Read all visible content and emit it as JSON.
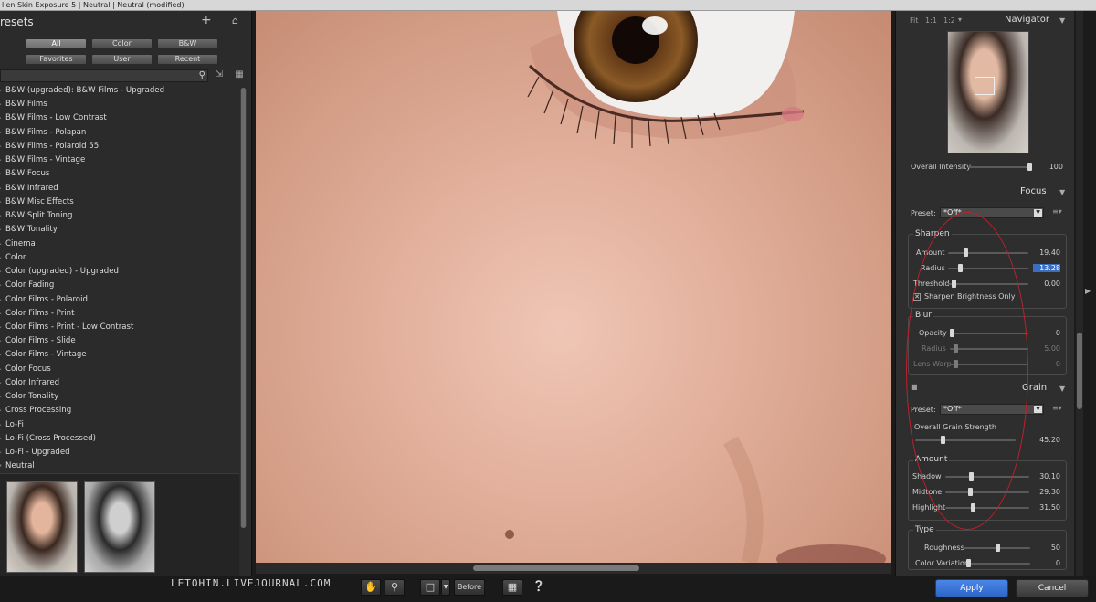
{
  "window": {
    "title": "lien Skin Exposure 5 | Neutral | Neutral (modified)"
  },
  "presets_panel": {
    "title": "resets",
    "add_icon": "+",
    "filters": [
      "All",
      "Color",
      "B&W",
      "Favorites",
      "User",
      "Recent"
    ],
    "active_filter": "All",
    "search": {
      "value": "",
      "placeholder": ""
    },
    "items": [
      "B&W (upgraded): B&W Films - Upgraded",
      "B&W Films",
      "B&W Films - Low Contrast",
      "B&W Films - Polapan",
      "B&W Films - Polaroid 55",
      "B&W Films - Vintage",
      "B&W Focus",
      "B&W Infrared",
      "B&W Misc Effects",
      "B&W Split Toning",
      "B&W Tonality",
      "Cinema",
      "Color",
      "Color (upgraded) - Upgraded",
      "Color Fading",
      "Color Films - Polaroid",
      "Color Films - Print",
      "Color Films - Print - Low Contrast",
      "Color Films - Slide",
      "Color Films - Vintage",
      "Color Focus",
      "Color Infrared",
      "Color Tonality",
      "Cross Processing",
      "Lo-Fi",
      "Lo-Fi (Cross Processed)",
      "Lo-Fi - Upgraded",
      "Neutral"
    ],
    "open_item": "Neutral"
  },
  "navigator": {
    "zoom_options": [
      "Fit",
      "1:1",
      "1:2"
    ],
    "title": "Navigator",
    "overall_intensity": {
      "label": "Overall Intensity",
      "value": "100",
      "level": 1.0
    }
  },
  "focus": {
    "title": "Focus",
    "preset_label": "Preset:",
    "preset_value": "*Off*",
    "sharpen": {
      "title": "Sharpen",
      "amount": {
        "label": "Amount",
        "value": "19.40",
        "level": 0.19
      },
      "radius": {
        "label": "Radius",
        "value": "13.28",
        "level": 0.13
      },
      "threshold": {
        "label": "Threshold",
        "value": "0.00",
        "level": 0.0
      },
      "brightness_only": {
        "label": "Sharpen Brightness Only",
        "checked": true
      }
    },
    "blur": {
      "title": "Blur",
      "opacity": {
        "label": "Opacity",
        "value": "0",
        "level": 0.0
      },
      "radius": {
        "label": "Radius",
        "value": "5.00",
        "level": 0.05
      },
      "lens_warp": {
        "label": "Lens Warp",
        "value": "0",
        "level": 0.0
      }
    }
  },
  "grain": {
    "title": "Grain",
    "preset_label": "Preset:",
    "preset_value": "*Off*",
    "overall": {
      "label": "Overall Grain Strength",
      "value": "45.20",
      "level": 0.45
    },
    "amount": {
      "title": "Amount",
      "shadow": {
        "label": "Shadow",
        "value": "30.10",
        "level": 0.3
      },
      "midtone": {
        "label": "Midtone",
        "value": "29.30",
        "level": 0.29
      },
      "highlight": {
        "label": "Highlight",
        "value": "31.50",
        "level": 0.32
      }
    },
    "type": {
      "title": "Type",
      "roughness": {
        "label": "Roughness",
        "value": "50",
        "level": 0.5
      },
      "color_variation": {
        "label": "Color Variation",
        "value": "0",
        "level": 0.0
      }
    }
  },
  "bottom_bar": {
    "watermark": "LETOHIN.LIVEJOURNAL.COM",
    "before_label": "Before",
    "apply_label": "Apply",
    "cancel_label": "Cancel"
  },
  "colors": {
    "accent": "#3a78d6",
    "annotation": "#c0202a",
    "panel": "#2e2e2e"
  }
}
